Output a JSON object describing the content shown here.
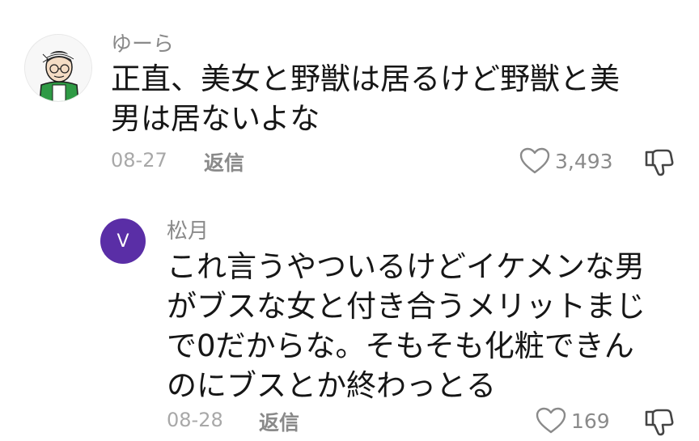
{
  "comments": [
    {
      "username": "ゆーら",
      "text_lines": [
        "正直、美女と野獣は居るけど野獣と美",
        "男は居ないよな"
      ],
      "date": "08-27",
      "reply_label": "返信",
      "likes": "3,493",
      "avatar_icon": "cartoon-avatar-icon"
    },
    {
      "username": "松月",
      "avatar_letter": "V",
      "avatar_color": "#5a2ea6",
      "text_lines": [
        "これ言うやついるけどイケメンな男",
        "がブスな女と付き合うメリットまじ",
        "で0だからな。そもそも化粧できん",
        "のにブスとか終わっとる"
      ],
      "date": "08-28",
      "reply_label": "返信",
      "likes": "169"
    }
  ]
}
